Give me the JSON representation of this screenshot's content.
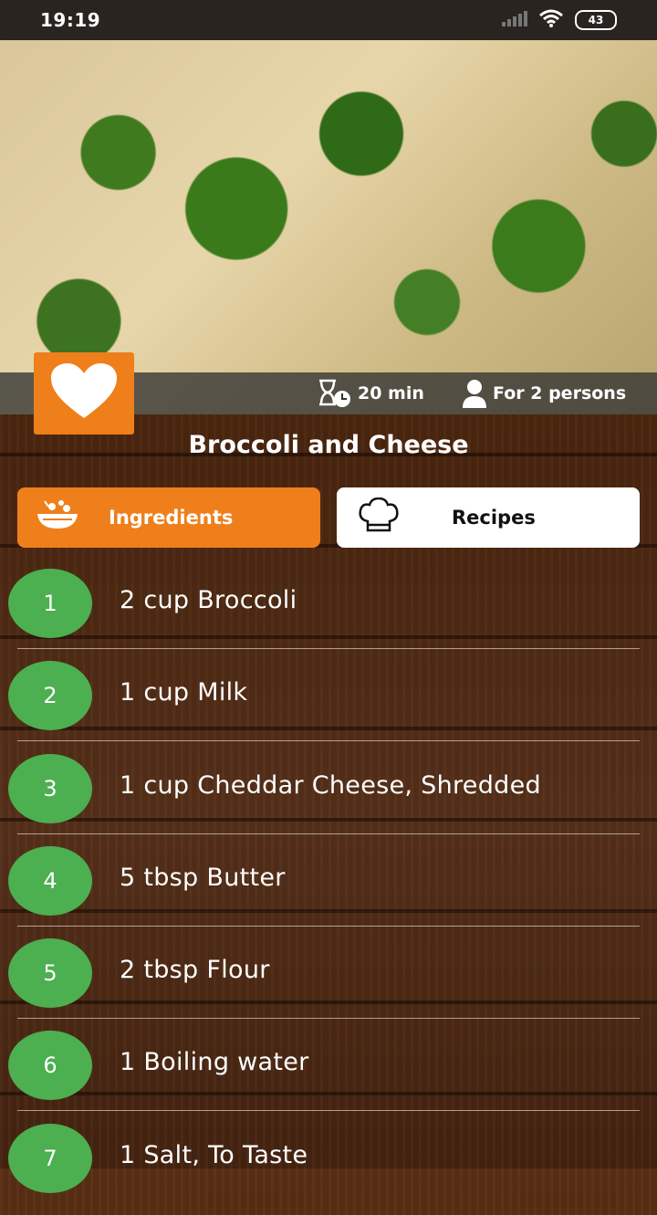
{
  "status_bar": {
    "time": "19:19",
    "battery": "43"
  },
  "recipe": {
    "title": "Broccoli and Cheese",
    "time": "20 min",
    "servings": "For 2 persons"
  },
  "tabs": [
    {
      "label": "Ingredients",
      "icon": "salad-bowl-icon",
      "active": true
    },
    {
      "label": "Recipes",
      "icon": "chef-hat-icon",
      "active": false
    }
  ],
  "ingredients": [
    {
      "num": "1",
      "text": "2 cup Broccoli"
    },
    {
      "num": "2",
      "text": "1 cup Milk"
    },
    {
      "num": "3",
      "text": "1 cup Cheddar Cheese, Shredded"
    },
    {
      "num": "4",
      "text": "5 tbsp Butter"
    },
    {
      "num": "5",
      "text": "2 tbsp Flour"
    },
    {
      "num": "6",
      "text": "1 Boiling water"
    },
    {
      "num": "7",
      "text": "1 Salt, To Taste"
    }
  ],
  "colors": {
    "accent": "#ef7f1a",
    "number_badge": "#4caf50",
    "wood": "#4a260f"
  }
}
